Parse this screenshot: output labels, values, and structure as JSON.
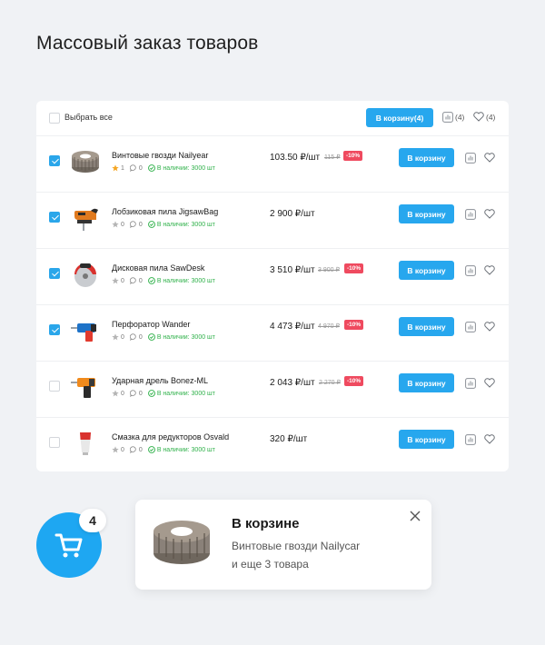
{
  "page_title": "Массовый заказ товаров",
  "header": {
    "select_all_label": "Выбрать все",
    "cart_button_label": "В корзину(4)",
    "compare_count": "(4)",
    "favorites_count": "(4)"
  },
  "rows": [
    {
      "name": "Винтовые гвозди Nailyear",
      "rating": "1",
      "comments": "0",
      "stock": "В наличии: 3000 шт",
      "price": "103.50 ₽/шт",
      "old_price": "115 ₽",
      "discount": "-10%",
      "button": "В корзину",
      "checked": true,
      "star_color": "#f5a623",
      "thumb_icon": "nails-icon"
    },
    {
      "name": "Лобзиковая пила JigsawBag",
      "rating": "0",
      "comments": "0",
      "stock": "В наличии: 3000 шт",
      "price": "2 900 ₽/шт",
      "old_price": "",
      "discount": "",
      "button": "В корзину",
      "checked": true,
      "star_color": "#b5b5b5",
      "thumb_icon": "jigsaw-icon"
    },
    {
      "name": "Дисковая пила SawDesk",
      "rating": "0",
      "comments": "0",
      "stock": "В наличии: 3000 шт",
      "price": "3 510 ₽/шт",
      "old_price": "3 900 ₽",
      "discount": "-10%",
      "button": "В корзину",
      "checked": true,
      "star_color": "#b5b5b5",
      "thumb_icon": "circular-saw-icon"
    },
    {
      "name": "Перфоратор Wander",
      "rating": "0",
      "comments": "0",
      "stock": "В наличии: 3000 шт",
      "price": "4 473 ₽/шт",
      "old_price": "4 970 ₽",
      "discount": "-10%",
      "button": "В корзину",
      "checked": true,
      "star_color": "#b5b5b5",
      "thumb_icon": "hammer-drill-icon"
    },
    {
      "name": "Ударная дрель Bonez-ML",
      "rating": "0",
      "comments": "0",
      "stock": "В наличии: 3000 шт",
      "price": "2 043 ₽/шт",
      "old_price": "2 270 ₽",
      "discount": "-10%",
      "button": "В корзину",
      "checked": false,
      "star_color": "#b5b5b5",
      "thumb_icon": "impact-drill-icon"
    },
    {
      "name": "Смазка для редукторов Osvald",
      "rating": "0",
      "comments": "0",
      "stock": "В наличии: 3000 шт",
      "price": "320 ₽/шт",
      "old_price": "",
      "discount": "",
      "button": "В корзину",
      "checked": false,
      "star_color": "#b5b5b5",
      "thumb_icon": "grease-tube-icon"
    }
  ],
  "cart_fab": {
    "count": "4",
    "color": "#1ea7f2"
  },
  "toast": {
    "title": "В корзине",
    "line1": "Винтовые гвозди Nailycar",
    "line2": "и еще 3 товара"
  },
  "colors": {
    "accent": "#27a7ee",
    "discount": "#ef4a5f",
    "stock": "#2fb14a"
  }
}
